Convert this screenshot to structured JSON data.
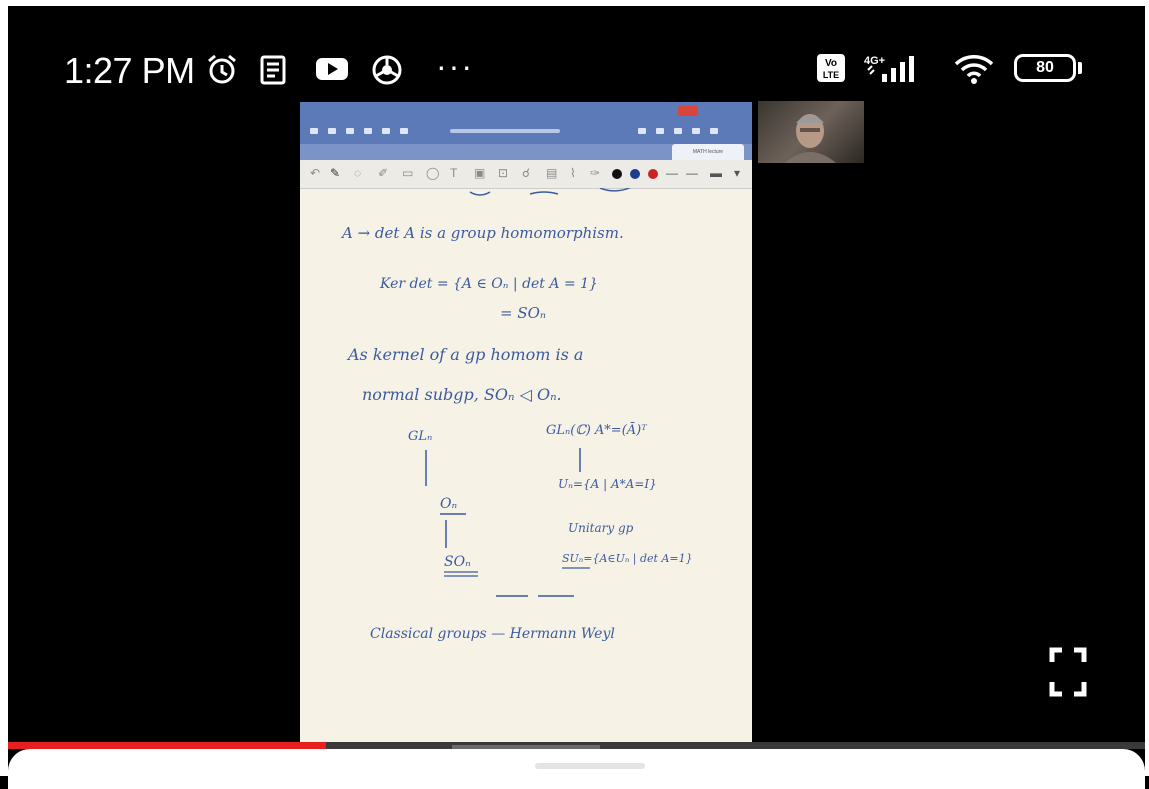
{
  "status_bar": {
    "time": "1:27 PM",
    "icons": [
      "alarm-icon",
      "notes-icon",
      "youtube-icon",
      "chrome-icon"
    ],
    "more": "···",
    "network": "4G+",
    "network_badge": "Vo LTE",
    "battery": "80"
  },
  "video": {
    "progress_fraction": 0.28,
    "shared_screen": {
      "app": "notes-app",
      "tab_label": "MATH lecture",
      "handwritten_lines": [
        "A → det A is a group homomorphism.",
        "Ker det = {A ∈ Oₙ | det A = 1}",
        "= SOₙ",
        "As kernel of a gp homom is a",
        "normal subgp, SOₙ ◁ Oₙ.",
        "GLₙ",
        "GLₙ(ℂ)   A*=(Ā)ᵀ",
        "Oₙ",
        "Uₙ={A | A*A=I}",
        "Unitary gp",
        "SOₙ",
        "SUₙ={A∈Uₙ | det A=1}",
        "Classical groups — Hermann Weyl"
      ]
    }
  },
  "colors": {
    "toolbar": "#5c7ab8",
    "ink": "#3d5aa0",
    "progress": "#e81f1f",
    "paper": "#f6f3e6"
  }
}
